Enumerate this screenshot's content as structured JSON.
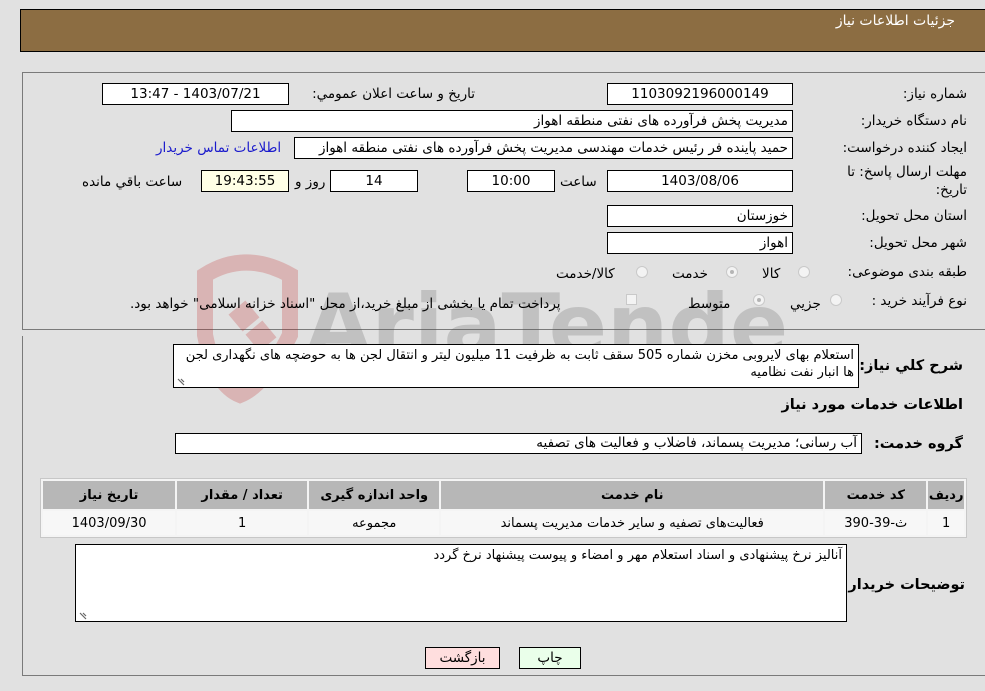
{
  "header": {
    "title": "جزئیات اطلاعات نیاز"
  },
  "form": {
    "need_number": {
      "label": "شماره نیاز:",
      "value": "1103092196000149"
    },
    "announce_datetime": {
      "label": "تاریخ و ساعت اعلان عمومي:",
      "value": "1403/07/21 - 13:47"
    },
    "buyer_org": {
      "label": "نام دستگاه خریدار:",
      "value": "مدیریت پخش فرآورده های نفتی منطقه اهواز"
    },
    "requester": {
      "label": "ایجاد کننده درخواست:",
      "value": "حمید پاینده فر رئیس خدمات مهندسی مدیریت پخش فرآورده های نفتی منطقه اهواز"
    },
    "contact_link": "اطلاعات تماس خریدار",
    "deadline": {
      "label_line1": "مهلت ارسال پاسخ: تا",
      "label_line2": "تاریخ:",
      "date": "1403/08/06",
      "time_label": "ساعت",
      "time": "10:00",
      "days": "14",
      "days_label": "روز و",
      "remaining": "19:43:55",
      "remaining_label": "ساعت باقي مانده"
    },
    "province": {
      "label": "استان محل تحویل:",
      "value": "خوزستان"
    },
    "city": {
      "label": "شهر محل تحویل:",
      "value": "اهواز"
    },
    "category": {
      "label": "طبقه بندی موضوعی:",
      "options": [
        "کالا",
        "خدمت",
        "کالا/خدمت"
      ],
      "selected": "خدمت"
    },
    "purchase_type": {
      "label": "نوع فرآیند خرید :",
      "options": [
        "جزیي",
        "متوسط"
      ],
      "selected": "متوسط",
      "treasury_note": "پرداخت تمام یا بخشی از مبلغ خرید،از محل \"اسناد خزانه اسلامی\" خواهد بود."
    }
  },
  "description": {
    "label": "شرح کلي نیاز:",
    "value": "استعلام بهای لایروبی مخزن شماره 505 سقف ثابت به ظرفیت 11 میلیون لیتر و انتقال لجن ها به حوضچه های نگهداری لجن ها انبار نفت نظامیه"
  },
  "services_section": {
    "title": "اطلاعات خدمات مورد نیاز"
  },
  "service_group": {
    "label": "گروه خدمت:",
    "value": "آب رسانی؛ مدیریت پسماند، فاضلاب و فعالیت های تصفیه"
  },
  "table": {
    "headers": [
      "ردیف",
      "کد خدمت",
      "نام خدمت",
      "واحد اندازه گیری",
      "تعداد / مقدار",
      "تاریخ نیاز"
    ],
    "rows": [
      [
        "1",
        "ث-39-390",
        "فعالیت‌های تصفیه و سایر خدمات مدیریت پسماند",
        "مجموعه",
        "1",
        "1403/09/30"
      ]
    ]
  },
  "buyer_notes": {
    "label": "توضیحات خریدار:",
    "value": "آنالیز نرخ پیشنهادی و اسناد استعلام مهر و امضاء و پیوست پیشنهاد نرخ گردد"
  },
  "buttons": {
    "print": "چاپ",
    "back": "بازگشت"
  },
  "watermark": "AriaTender.neT",
  "colors": {
    "header_bg": "#8c6d42",
    "link": "#1a1acc",
    "print_bg": "#eaffea",
    "back_bg": "#ffdede",
    "remaining_bg": "#ffffe6"
  }
}
